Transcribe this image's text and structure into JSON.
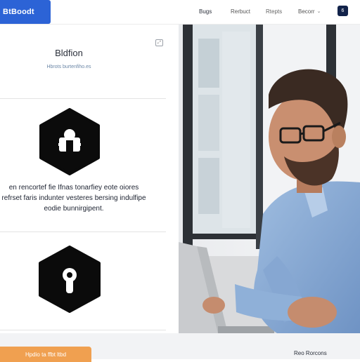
{
  "header": {
    "brand": "BtBoodt",
    "nav": [
      {
        "label": "Bugs"
      },
      {
        "label": "Rerbuct"
      },
      {
        "label": "Rtepts"
      },
      {
        "label": "Becorr"
      }
    ],
    "avatar_label": "6",
    "brand_color": "#2c63d6"
  },
  "panel": {
    "title": "Bldfion",
    "subtitle": "Hbrots burtenfiho.es",
    "description_lines": [
      "en rencortef fie Ifnas tonarfiey eote oiores",
      "refrset faris indunter vesteres bersing indulfipe",
      "eodie bunnirgipent."
    ],
    "icons": [
      "puzzle-icon",
      "lock-icon"
    ]
  },
  "footer": {
    "cta_label": "Hpdio ta ffbt ltbd",
    "link_label": "Reo Rorcons",
    "cta_color": "#f0a050"
  }
}
